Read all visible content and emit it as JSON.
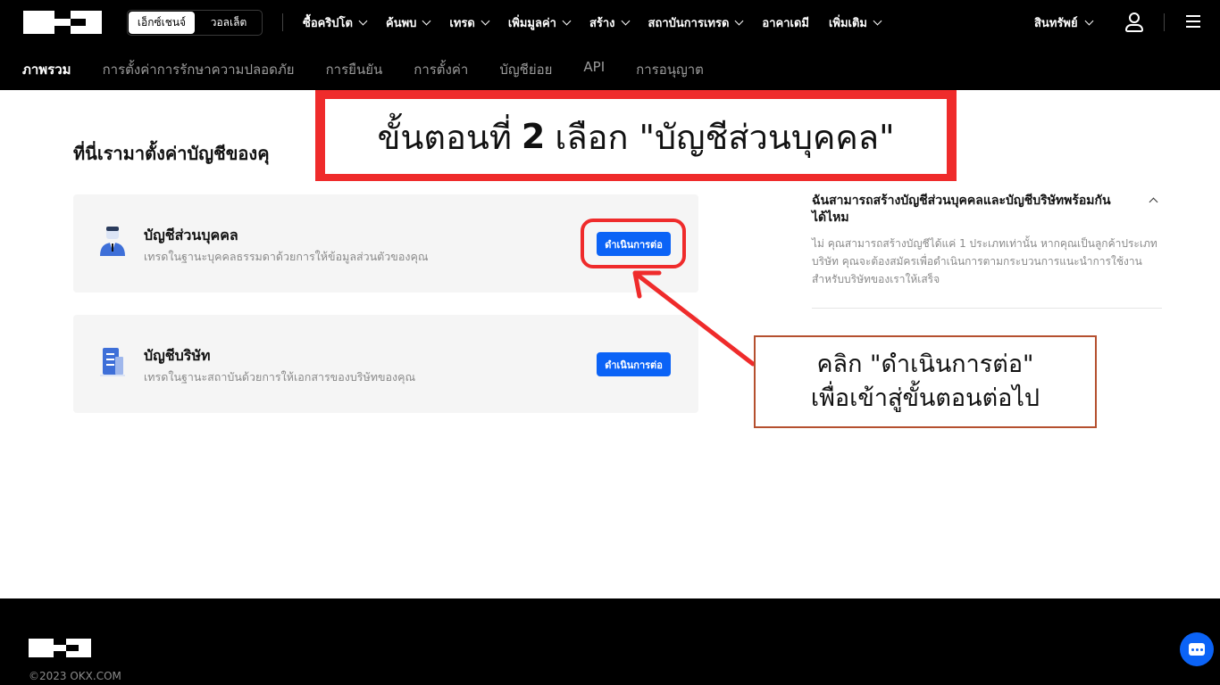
{
  "header": {
    "brand": "OKX",
    "mode_toggle": [
      "เอ็กซ์เชนจ์",
      "วอลเล็ต"
    ],
    "menu": [
      {
        "label": "ซื้อคริปโต",
        "dropdown": true
      },
      {
        "label": "ค้นพบ",
        "dropdown": true
      },
      {
        "label": "เทรด",
        "dropdown": true
      },
      {
        "label": "เพิ่มมูลค่า",
        "dropdown": true
      },
      {
        "label": "สร้าง",
        "dropdown": true
      },
      {
        "label": "สถาบันการเทรด",
        "dropdown": true
      },
      {
        "label": "อาคาเดมี",
        "dropdown": false
      },
      {
        "label": "เพิ่มเติม",
        "dropdown": true
      }
    ],
    "assets_label": "สินทรัพย์"
  },
  "subnav": [
    "ภาพรวม",
    "การตั้งค่าการรักษาความปลอดภัย",
    "การยืนยัน",
    "การตั้งค่า",
    "บัญชีย่อย",
    "API",
    "การอนุญาต"
  ],
  "main": {
    "heading": "ที่นี่เรามาตั้งค่าบัญชีของคุ",
    "accounts": [
      {
        "title": "บัญชีส่วนบุคคล",
        "desc": "เทรดในฐานะบุคคลธรรมดาด้วยการให้ข้อมูลส่วนตัวของคุณ",
        "button": "ดำเนินการต่อ",
        "icon": "person-icon"
      },
      {
        "title": "บัญชีบริษัท",
        "desc": "เทรดในฐานะสถาบันด้วยการให้เอกสารของบริษัทของคุณ",
        "button": "ดำเนินการต่อ",
        "icon": "building-icon"
      }
    ]
  },
  "faq": {
    "question": "ฉันสามารถสร้างบัญชีส่วนบุคคลและบัญชีบริษัทพร้อมกันได้ไหม",
    "answer": "ไม่ คุณสามารถสร้างบัญชีได้แค่ 1 ประเภทเท่านั้น หากคุณเป็นลูกค้าประเภทบริษัท คุณจะต้องสมัครเพื่อดำเนินการตามกระบวนการแนะนำการใช้งานสำหรับบริษัทของเราให้เสร็จ"
  },
  "annotations": {
    "banner_pre": "ขั้นตอนที่",
    "banner_num": "2",
    "banner_post": "เลือก \"บัญชีส่วนบุคคล\"",
    "callout_line1": "คลิก \"ดำเนินการต่อ\"",
    "callout_line2": "เพื่อเข้าสู่ขั้นตอนต่อไป",
    "accent_color": "#ef2b2b"
  },
  "footer": {
    "brand": "OKX",
    "copyright": "©2023 OKX.COM"
  },
  "colors": {
    "primary": "#0b63f6",
    "header_bg": "#000000"
  }
}
